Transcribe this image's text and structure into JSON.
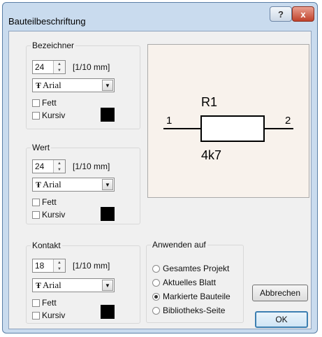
{
  "window": {
    "title": "Bauteilbeschriftung",
    "help_label": "?",
    "close_label": "x"
  },
  "groups": [
    {
      "legend": "Bezeichner",
      "size": "24",
      "unit": "[1/10 mm]",
      "font": "Arial",
      "bold_label": "Fett",
      "italic_label": "Kursiv",
      "color": "#000000"
    },
    {
      "legend": "Wert",
      "size": "24",
      "unit": "[1/10 mm]",
      "font": "Arial",
      "bold_label": "Fett",
      "italic_label": "Kursiv",
      "color": "#000000"
    },
    {
      "legend": "Kontakt",
      "size": "18",
      "unit": "[1/10 mm]",
      "font": "Arial",
      "bold_label": "Fett",
      "italic_label": "Kursiv",
      "color": "#000000"
    }
  ],
  "preview": {
    "name": "R1",
    "value": "4k7",
    "pin1": "1",
    "pin2": "2"
  },
  "apply": {
    "legend": "Anwenden auf",
    "options": [
      "Gesamtes Projekt",
      "Aktuelles Blatt",
      "Markierte Bauteile",
      "Bibliotheks-Seite"
    ],
    "selected": "Markierte Bauteile"
  },
  "buttons": {
    "cancel": "Abbrechen",
    "ok": "OK"
  }
}
